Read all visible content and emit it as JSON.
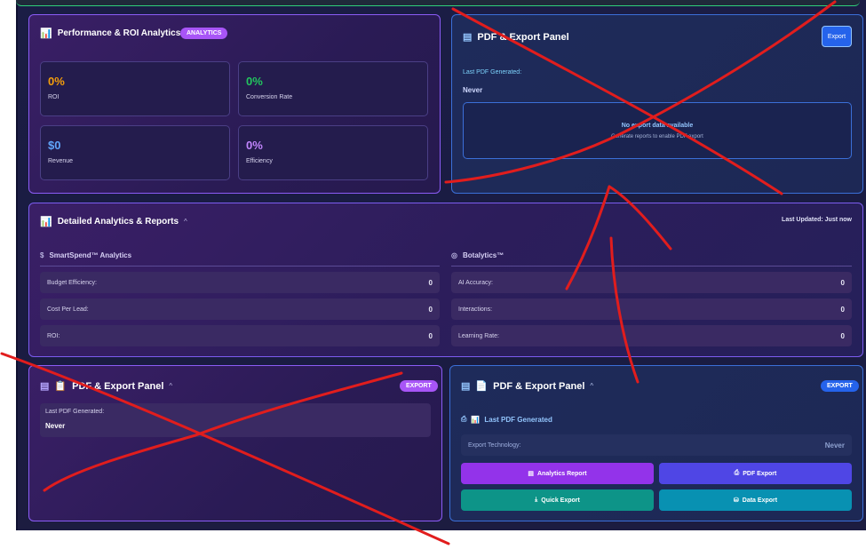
{
  "performance": {
    "title": "Performance & ROI Analytics",
    "badge": "ANALYTICS",
    "metrics": [
      {
        "value": "0%",
        "label": "ROI",
        "color": "#f59e0b"
      },
      {
        "value": "0%",
        "label": "Conversion Rate",
        "color": "#22c55e"
      },
      {
        "value": "$0",
        "label": "Revenue",
        "color": "#60a5fa"
      },
      {
        "value": "0%",
        "label": "Efficiency",
        "color": "#c084fc"
      }
    ]
  },
  "pdf_top": {
    "title": "PDF & Export Panel",
    "export_button": "Export",
    "last_label": "Last PDF Generated:",
    "last_value": "Never",
    "empty_title": "No export data available",
    "empty_sub": "Generate reports to enable PDF export"
  },
  "detailed": {
    "title": "Detailed Analytics & Reports",
    "collapse_glyph": "^",
    "last_updated": "Last Updated: Just now",
    "smartspend": {
      "title": "SmartSpend™ Analytics",
      "rows": [
        {
          "label": "Budget Efficiency:",
          "value": "0"
        },
        {
          "label": "Cost Per Lead:",
          "value": "0"
        },
        {
          "label": "ROI:",
          "value": "0"
        }
      ]
    },
    "botalytics": {
      "title": "Botalytics™",
      "rows": [
        {
          "label": "AI Accuracy:",
          "value": "0"
        },
        {
          "label": "Interactions:",
          "value": "0"
        },
        {
          "label": "Learning Rate:",
          "value": "0"
        }
      ]
    }
  },
  "pdf_left": {
    "title": "PDF & Export Panel",
    "badge": "EXPORT",
    "last_label": "Last PDF Generated:",
    "last_value": "Never"
  },
  "pdf_right": {
    "title": "PDF & Export Panel",
    "badge": "EXPORT",
    "section_title": "Last PDF Generated",
    "tech_label": "Export Technology:",
    "tech_value": "Never",
    "buttons": {
      "analytics_report": "Analytics Report",
      "pdf_export": "PDF Export",
      "quick_export": "Quick Export",
      "data_export": "Data Export"
    }
  },
  "colors": {
    "purple_border": "#8b5cf6",
    "blue_border": "#3b6fd8",
    "annotation_red": "#e11d1d"
  }
}
